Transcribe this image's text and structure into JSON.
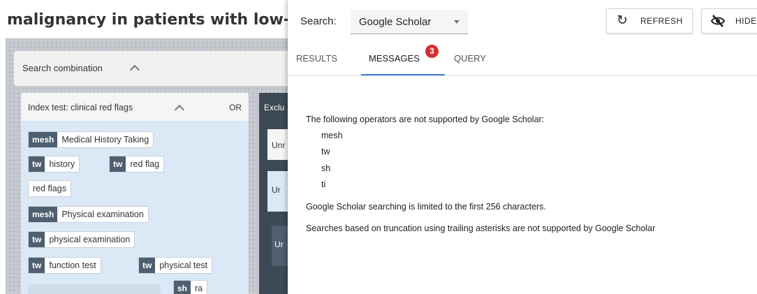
{
  "document": {
    "title": "malignancy in patients with low-back pain"
  },
  "builder": {
    "search_combination_label": "Search combination",
    "index_group": {
      "label": "Index test: clinical red flags",
      "operator": "OR",
      "terms": [
        {
          "tag": "mesh",
          "text": "Medical History Taking"
        },
        {
          "tag": "tw",
          "text": "history"
        },
        {
          "tag": "tw",
          "text": "red flag"
        },
        {
          "tag": "",
          "text": "red flags"
        },
        {
          "tag": "mesh",
          "text": "Physical examination"
        },
        {
          "tag": "tw",
          "text": "physical examination"
        },
        {
          "tag": "tw",
          "text": "function test"
        },
        {
          "tag": "tw",
          "text": "physical test"
        },
        {
          "tag": "sh",
          "text": "ra"
        }
      ]
    },
    "exclusion_group": {
      "label": "Exclu",
      "sub1": "Unr",
      "sub2": "Ur",
      "sub3": "Ur"
    }
  },
  "panel": {
    "search_label": "Search:",
    "engine": "Google Scholar",
    "refresh_label": "REFRESH",
    "hide_label": "HIDE",
    "tabs": [
      {
        "label": "RESULTS"
      },
      {
        "label": "MESSAGES",
        "badge": "3",
        "active": true
      },
      {
        "label": "QUERY"
      }
    ],
    "messages": {
      "operators_title": "The following operators are not supported by Google Scholar:",
      "operators": [
        "mesh",
        "tw",
        "sh",
        "ti"
      ],
      "limit": "Google Scholar searching is limited to the first 256 characters.",
      "truncation": "Searches based on truncation using trailing asterisks are not supported by Google Scholar"
    }
  },
  "colors": {
    "accent": "#3f7fd9",
    "badge": "#d32f2f",
    "tag": "#4f5f6f",
    "group_bg": "#dbe9f7"
  },
  "icons": {
    "refresh": "refresh-icon",
    "hide": "eye-off-icon",
    "dropdown": "caret-down-icon",
    "collapse": "chevron-up-icon"
  }
}
